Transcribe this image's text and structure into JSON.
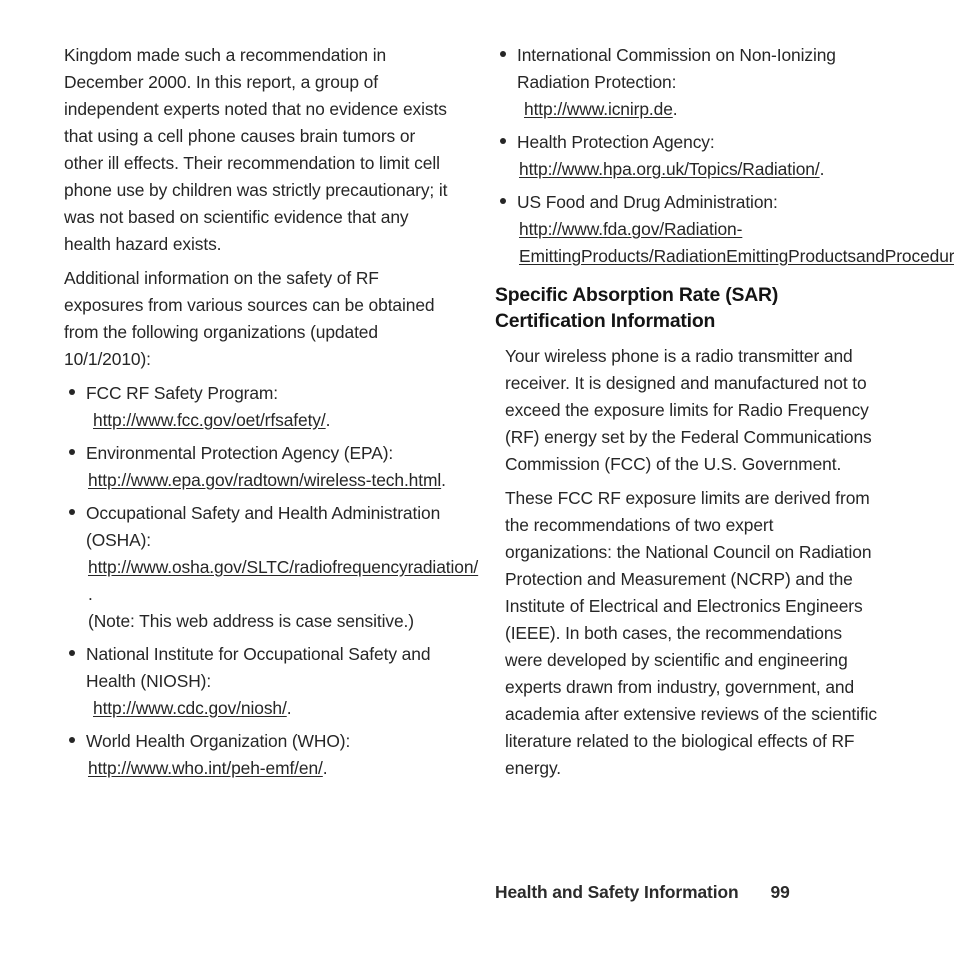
{
  "page": {
    "left_column": {
      "paragraphs": [
        "Kingdom made such a recommendation in December 2000. In this report, a group of independent experts noted that no evidence exists that using a cell phone causes brain tumors or other ill effects. Their recommendation to limit cell phone use by children was strictly precautionary; it was not based on scientific evidence that any health hazard exists.",
        "Additional information on the safety of RF exposures from various sources can be obtained from the following organizations (updated 10/1/2010):"
      ],
      "bullets": [
        {
          "label": "FCC RF Safety Program:",
          "url": "http://www.fcc.gov/oet/rfsafety/",
          "trailing": "."
        },
        {
          "label": "Environmental Protection Agency (EPA):",
          "url": "http://www.epa.gov/radtown/wireless-tech.html",
          "trailing": "."
        },
        {
          "label": "Occupational Safety and Health Administration (OSHA):",
          "url": "http://www.osha.gov/SLTC/radiofrequencyradiation/",
          "trailing": ".",
          "note": "(Note: This web address is case sensitive.)"
        },
        {
          "label": "National Institute for Occupational Safety and Health (NIOSH):",
          "url": "http://www.cdc.gov/niosh/",
          "trailing": "."
        },
        {
          "label": "World Health Organization (WHO):",
          "url": "http://www.who.int/peh-emf/en/",
          "trailing": "."
        }
      ]
    },
    "right_column": {
      "bullets": [
        {
          "label": "International Commission on Non-Ionizing Radiation Protection:",
          "url": "http://www.icnirp.de",
          "trailing": "."
        },
        {
          "label": "Health Protection Agency:",
          "url": "http://www.hpa.org.uk/Topics/Radiation/",
          "trailing": "."
        },
        {
          "label": "US Food and Drug Administration:",
          "url": "http://www.fda.gov/Radiation-EmittingProducts/RadiationEmittingProductsandProcedures/HomeBusinessandEntertainment/CellPhones/default.htm",
          "trailing": "."
        }
      ],
      "heading": "Specific Absorption Rate (SAR) Certification Information",
      "paragraphs": [
        "Your wireless phone is a radio transmitter and receiver. It is designed and manufactured not to exceed the exposure limits for Radio Frequency (RF) energy set by the Federal Communications Commission (FCC) of the U.S. Government.",
        "These FCC RF exposure limits are derived from the recommendations of two expert organizations: the National Council on Radiation Protection and Measurement (NCRP) and the Institute of Electrical and Electronics Engineers (IEEE). In both cases, the recommendations were developed by scientific and engineering experts drawn from industry, government, and academia after extensive reviews of the scientific literature related to the biological effects of RF energy."
      ]
    },
    "footer": {
      "title": "Health and Safety Information",
      "page_number": "99"
    }
  }
}
